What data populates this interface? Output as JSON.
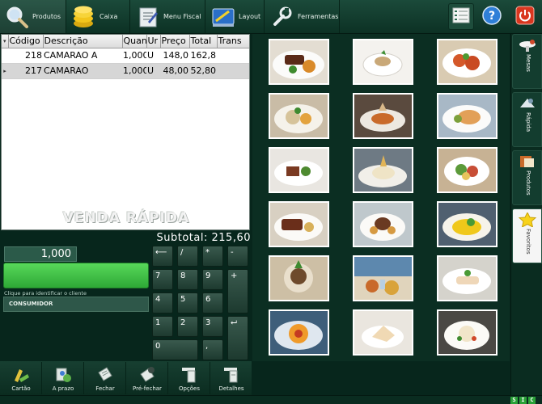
{
  "toolbar": {
    "produtos": "Produtos",
    "caixa": "Caixa",
    "menu_fiscal": "Menu Fiscal",
    "layout": "Layout",
    "ferramentas": "Ferramentas",
    "icons": {
      "produtos": "magnifier-icon",
      "caixa": "coins-icon",
      "menu_fiscal": "fiscal-menu-icon",
      "layout": "layout-icon",
      "ferramentas": "wrench-icon",
      "list": "list-icon",
      "help": "help-icon",
      "power": "power-icon"
    }
  },
  "order": {
    "columns": [
      "Código",
      "Descrição",
      "Quan",
      "Ur",
      "Preço",
      "Total",
      "Trans"
    ],
    "rows": [
      {
        "codigo": "218",
        "descricao": "CAMARAO A",
        "quantidade": "1,000",
        "unidade": "U",
        "preco": "148,0",
        "total": "162,8",
        "trans": ""
      },
      {
        "codigo": "217",
        "descricao": "CAMARAO",
        "quantidade": "1,000",
        "unidade": "U",
        "preco": "48,00",
        "total": "52,80",
        "trans": "",
        "selected": true
      }
    ],
    "mode_label": "VENDA RÁPIDA"
  },
  "subtotal": {
    "label": "Subtotal:",
    "value": "215,60"
  },
  "entry": {
    "quantity": "1,000",
    "client_hint": "Clique para identificar o cliente",
    "client_name": "CONSUMIDOR"
  },
  "keypad": {
    "backspace": "⟵",
    "divide": "/",
    "multiply": "*",
    "minus": "-",
    "plus": "+",
    "enter": "⮠",
    "decimal": ",",
    "digits": [
      "0",
      "1",
      "2",
      "3",
      "4",
      "5",
      "6",
      "7",
      "8",
      "9"
    ]
  },
  "actions": {
    "cartao": "Cartão",
    "a_prazo": "A prazo",
    "fechar": "Fechar",
    "pre_fechar": "Pré-fechar",
    "opcoes": "Opções",
    "detalhes": "Detalhes"
  },
  "side_tabs": {
    "mesas": "Mesas",
    "rapida": "Rápida",
    "produtos": "Produtos",
    "favoritos": "Favoritos",
    "active": "favoritos"
  },
  "status_flags": [
    "S",
    "I",
    "C"
  ],
  "colors": {
    "background": "#07261c",
    "accent_green": "#2ea836",
    "help_blue": "#2f7fd8",
    "power_red": "#d9361f",
    "favorite_star": "#f7d21a"
  }
}
